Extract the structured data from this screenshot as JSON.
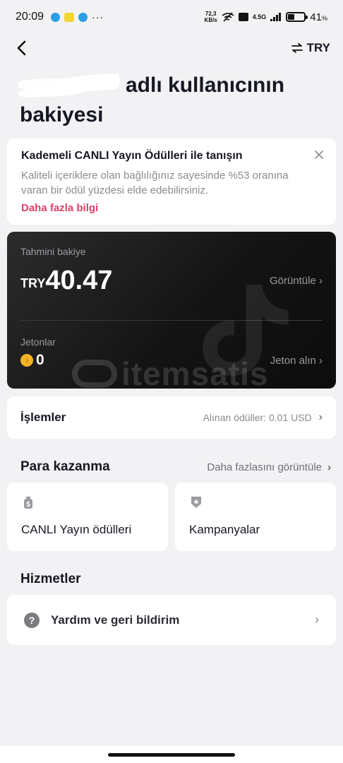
{
  "status_bar": {
    "time": "20:09",
    "more": "···",
    "net_speed_value": "72,3",
    "net_speed_unit": "KB/s",
    "network": "4.5G",
    "battery_percent": "41",
    "battery_unit": "%",
    "battery_level": 0.41
  },
  "nav": {
    "currency_label": "TRY"
  },
  "header": {
    "title_line1": "adlı kullanıcının",
    "title_line2": "bakiyesi"
  },
  "promo": {
    "title": "Kademeli CANLI Yayın Ödülleri ile tanışın",
    "description": "Kaliteli içeriklere olan bağlılığınız sayesinde %53 oranına varan bir ödül yüzdesi elde edebilirsiniz.",
    "link": "Daha fazla bilgi"
  },
  "balance": {
    "label": "Tahmini bakiye",
    "currency": "TRY",
    "amount": "40.47",
    "view_link": "Görüntüle ›",
    "coins_label": "Jetonlar",
    "coins": "0",
    "get_coins_link": "Jeton alın ›",
    "watermark": "itemsatis"
  },
  "transactions": {
    "title": "İşlemler",
    "meta": "Alınan ödüller: 0.01 USD",
    "chevron": "›"
  },
  "earn": {
    "title": "Para kazanma",
    "more_link": "Daha fazlasını görüntüle",
    "chevron": "›",
    "tiles": [
      {
        "label": "CANLI Yayın ödülleri",
        "icon": "money-bag-icon"
      },
      {
        "label": "Kampanyalar",
        "icon": "star-badge-icon"
      }
    ]
  },
  "services": {
    "title": "Hizmetler",
    "help_label": "Yardım ve geri bildirim",
    "help_icon": "?",
    "chevron": "›"
  },
  "colors": {
    "accent": "#e23d6a",
    "background": "#f2f2f4",
    "balance_card": "#1a1a1a"
  }
}
